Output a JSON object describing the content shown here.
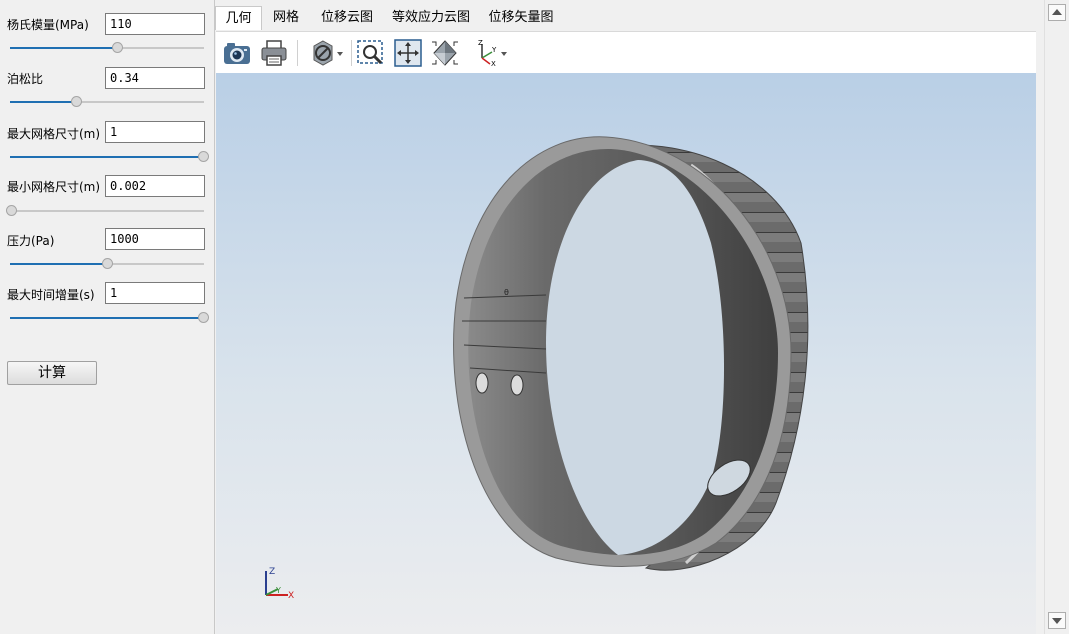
{
  "params": [
    {
      "label": "杨氏模量(MPa)",
      "value": "110",
      "slider": 0.55
    },
    {
      "label": "泊松比",
      "value": "0.34",
      "slider": 0.34
    },
    {
      "label": "最大网格尺寸(m)",
      "value": "1",
      "slider": 1.0
    },
    {
      "label": "最小网格尺寸(m)",
      "value": "0.002",
      "slider": 0.0
    },
    {
      "label": "压力(Pa)",
      "value": "1000",
      "slider": 0.5
    },
    {
      "label": "最大时间增量(s)",
      "value": "1",
      "slider": 1.0
    }
  ],
  "calc_button": "计算",
  "tabs": [
    "几何",
    "网格",
    "位移云图",
    "等效应力云图",
    "位移矢量图"
  ],
  "active_tab": 0,
  "toolbar": [
    "camera-icon",
    "print-icon",
    "view-style-icon",
    "zoom-box-icon",
    "fit-all-icon",
    "view-cube-icon",
    "axes-orientation-icon"
  ],
  "triad": {
    "z": "Z",
    "y": "Y",
    "x": "X"
  },
  "colors": {
    "accent": "#1f6fb2",
    "model": "#6e6e6e"
  }
}
